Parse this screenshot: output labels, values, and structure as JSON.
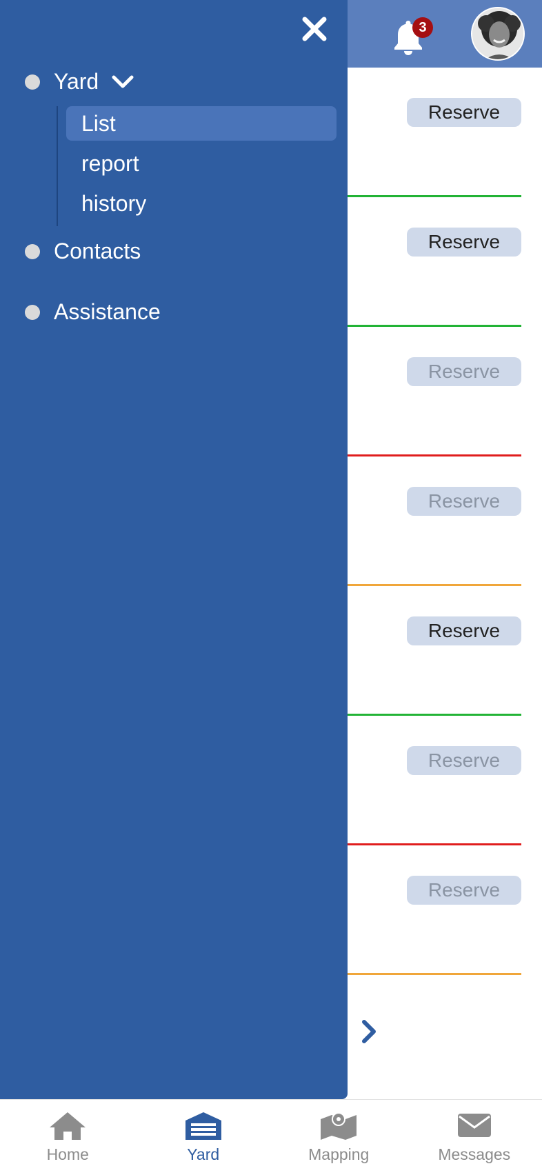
{
  "header": {
    "notification_count": "3"
  },
  "list": {
    "items": [
      {
        "button": "Reserve",
        "enabled": true,
        "status_color": "#22b335"
      },
      {
        "button": "Reserve",
        "enabled": true,
        "status_color": "#22b335"
      },
      {
        "button": "Reserve",
        "enabled": false,
        "status_color": "#e01d1d"
      },
      {
        "button": "Reserve",
        "enabled": false,
        "status_color": "#f0a63a"
      },
      {
        "button": "Reserve",
        "enabled": true,
        "status_color": "#22b335"
      },
      {
        "button": "Reserve",
        "enabled": false,
        "status_color": "#e01d1d"
      },
      {
        "button": "Reserve",
        "enabled": false,
        "status_color": "#f0a63a"
      }
    ]
  },
  "drawer": {
    "menu": [
      {
        "label": "Yard",
        "expanded": true
      },
      {
        "label": "Contacts"
      },
      {
        "label": "Assistance"
      }
    ],
    "yard_submenu": [
      {
        "label": "List",
        "active": true
      },
      {
        "label": "report"
      },
      {
        "label": "history"
      }
    ]
  },
  "bottom_nav": [
    {
      "label": "Home",
      "icon": "home-icon"
    },
    {
      "label": "Yard",
      "icon": "garage-icon",
      "active": true
    },
    {
      "label": "Mapping",
      "icon": "map-icon"
    },
    {
      "label": "Messages",
      "icon": "envelope-icon"
    }
  ],
  "colors": {
    "primary": "#2f5da1",
    "header": "#5b7fbd",
    "status_ok": "#22b335",
    "status_bad": "#e01d1d",
    "status_warn": "#f0a63a"
  }
}
